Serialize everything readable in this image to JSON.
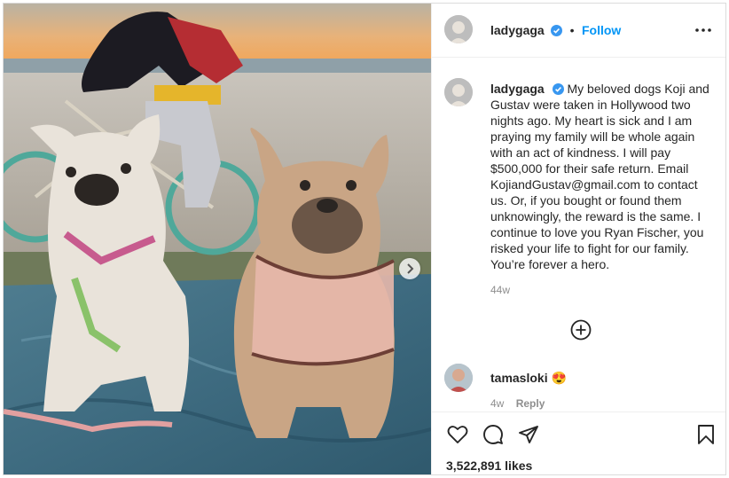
{
  "post": {
    "author": "ladygaga",
    "follow_label": "Follow",
    "separator": "•",
    "caption": "My beloved dogs Koji and Gustav were taken in Hollywood two nights ago. My heart is sick and I am praying my family will be whole again with an act of kindness. I will pay $500,000 for their safe return. Email KojiandGustav@gmail.com to contact us. Or, if you bought or found them unknowingly, the reward is the same. I continue to love you Ryan Fischer, you risked your life to fight for our family. You’re forever a hero.",
    "time_ago": "44w",
    "likes": "3,522,891 likes"
  },
  "comments": [
    {
      "user": "tamasloki",
      "emoji": "😍",
      "time": "4w",
      "reply_label": "Reply"
    }
  ],
  "icons": {
    "verified": "verified-badge-icon",
    "more": "more-options-icon",
    "add": "plus-circle-icon",
    "like": "heart-icon",
    "comment": "comment-icon",
    "share": "share-icon",
    "save": "bookmark-icon",
    "next": "chevron-right-icon"
  },
  "colors": {
    "accent": "#0095f6",
    "verified": "#3897f0",
    "muted": "#8e8e8e",
    "border": "#efefef"
  }
}
